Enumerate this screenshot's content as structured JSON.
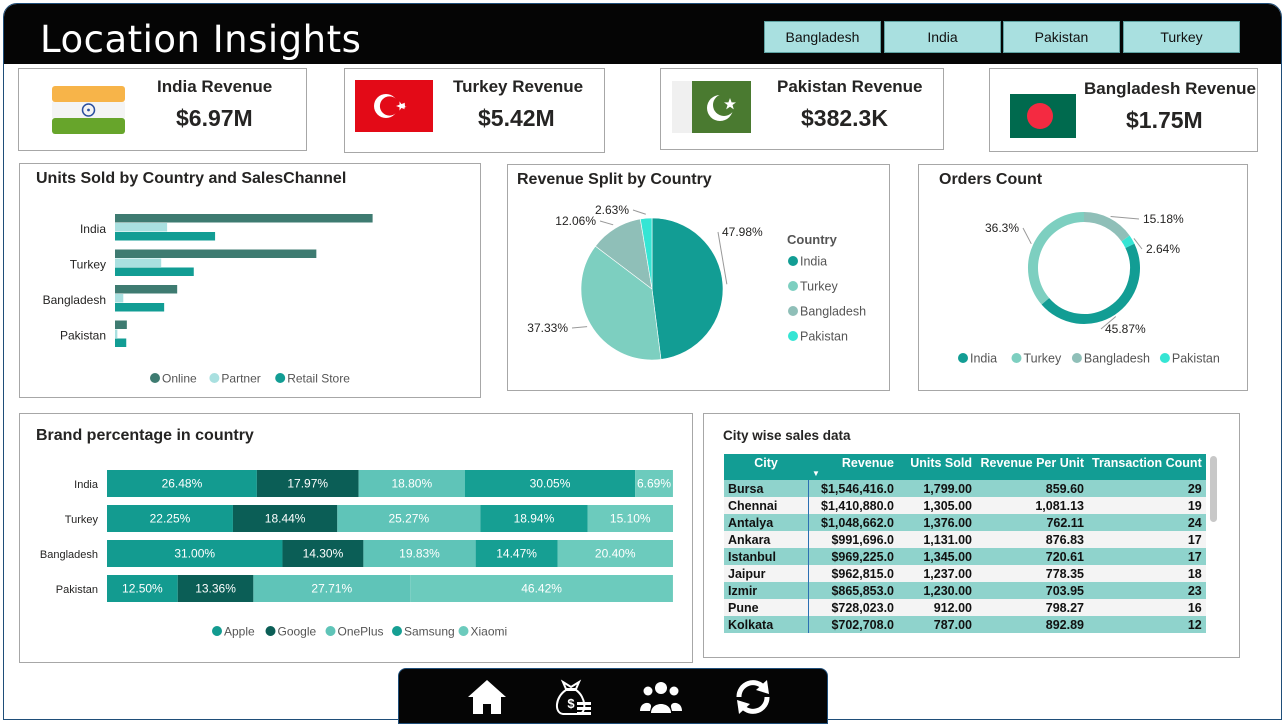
{
  "header": {
    "title": "Location Insights"
  },
  "slicers": [
    "Bangladesh",
    "India",
    "Pakistan",
    "Turkey"
  ],
  "kpis": [
    {
      "label": "India Revenue",
      "value": "$6.97M",
      "flag": "india-flag-icon"
    },
    {
      "label": "Turkey Revenue",
      "value": "$5.42M",
      "flag": "turkey-flag-icon"
    },
    {
      "label": "Pakistan Revenue",
      "value": "$382.3K",
      "flag": "pakistan-flag-icon"
    },
    {
      "label": "Bangladesh Revenue",
      "value": "$1.75M",
      "flag": "bangladesh-flag-icon"
    }
  ],
  "colors": {
    "online": "#3e7b71",
    "partner": "#a9e0e0",
    "retail": "#129d94",
    "india": "#129d94",
    "turkey": "#7dcfc0",
    "bangladesh": "#8fbfb8",
    "pakistan": "#35e5d4",
    "apple": "#139b90",
    "google": "#0b5e56",
    "oneplus": "#5fc4b8",
    "samsung": "#169f93",
    "xiaomi": "#6ccbbd"
  },
  "chart_data": [
    {
      "type": "bar",
      "title": "Units Sold by Country and SalesChannel",
      "orientation": "horizontal",
      "categories": [
        "India",
        "Turkey",
        "Bangladesh",
        "Pakistan"
      ],
      "series": [
        {
          "name": "Online",
          "values": [
            4350,
            3400,
            1050,
            200
          ]
        },
        {
          "name": "Partner",
          "values": [
            880,
            780,
            140,
            40
          ]
        },
        {
          "name": "Retail Store",
          "values": [
            1690,
            1330,
            830,
            190
          ]
        }
      ],
      "legend": "bottom",
      "xlim": [
        0,
        5000
      ]
    },
    {
      "type": "pie",
      "title": "Revenue Split by Country",
      "legend_title": "Country",
      "categories": [
        "India",
        "Turkey",
        "Bangladesh",
        "Pakistan"
      ],
      "values": [
        47.98,
        37.33,
        12.06,
        2.63
      ],
      "labels": [
        "47.98%",
        "37.33%",
        "12.06%",
        "2.63%"
      ],
      "legend": "right"
    },
    {
      "type": "pie",
      "variant": "donut",
      "title": "Orders Count",
      "categories": [
        "India",
        "Turkey",
        "Bangladesh",
        "Pakistan"
      ],
      "values": [
        45.87,
        36.3,
        15.18,
        2.64
      ],
      "labels": [
        "45.87%",
        "36.3%",
        "15.18%",
        "2.64%"
      ],
      "legend": "bottom"
    },
    {
      "type": "bar",
      "variant": "100% stacked",
      "title": "Brand percentage in country",
      "orientation": "horizontal",
      "categories": [
        "India",
        "Turkey",
        "Bangladesh",
        "Pakistan"
      ],
      "series": [
        {
          "name": "Apple",
          "values": [
            26.48,
            22.25,
            31.0,
            12.5
          ],
          "labels": [
            "26.48%",
            "22.25%",
            "31.00%",
            "12.50%"
          ]
        },
        {
          "name": "Google",
          "values": [
            17.97,
            18.44,
            14.3,
            13.36
          ],
          "labels": [
            "17.97%",
            "18.44%",
            "14.30%",
            "13.36%"
          ]
        },
        {
          "name": "OnePlus",
          "values": [
            18.8,
            25.27,
            19.83,
            27.71
          ],
          "labels": [
            "18.80%",
            "25.27%",
            "19.83%",
            "27.71%"
          ]
        },
        {
          "name": "Samsung",
          "values": [
            30.05,
            18.94,
            14.47,
            0
          ],
          "labels": [
            "30.05%",
            "18.94%",
            "14.47%",
            ""
          ]
        },
        {
          "name": "Xiaomi",
          "values": [
            6.69,
            15.1,
            20.4,
            46.42
          ],
          "labels": [
            "6.69%",
            "15.10%",
            "20.40%",
            "46.42%"
          ]
        }
      ],
      "legend": "bottom"
    }
  ],
  "city_table": {
    "title": "City wise sales data",
    "columns": [
      "City",
      "Revenue",
      "Units Sold",
      "Revenue Per Unit",
      "Transaction Count"
    ],
    "sort_column": "Revenue",
    "rows": [
      [
        "Bursa",
        "$1,546,416.0",
        "1,799.00",
        "859.60",
        "29"
      ],
      [
        "Chennai",
        "$1,410,880.0",
        "1,305.00",
        "1,081.13",
        "19"
      ],
      [
        "Antalya",
        "$1,048,662.0",
        "1,376.00",
        "762.11",
        "24"
      ],
      [
        "Ankara",
        "$991,696.0",
        "1,131.00",
        "876.83",
        "17"
      ],
      [
        "Istanbul",
        "$969,225.0",
        "1,345.00",
        "720.61",
        "17"
      ],
      [
        "Jaipur",
        "$962,815.0",
        "1,237.00",
        "778.35",
        "18"
      ],
      [
        "Izmir",
        "$865,853.0",
        "1,230.00",
        "703.95",
        "23"
      ],
      [
        "Pune",
        "$728,023.0",
        "912.00",
        "798.27",
        "16"
      ],
      [
        "Kolkata",
        "$702,708.0",
        "787.00",
        "892.89",
        "12"
      ]
    ]
  },
  "nav": [
    "home-icon",
    "money-bag-icon",
    "users-icon",
    "refresh-icon"
  ]
}
